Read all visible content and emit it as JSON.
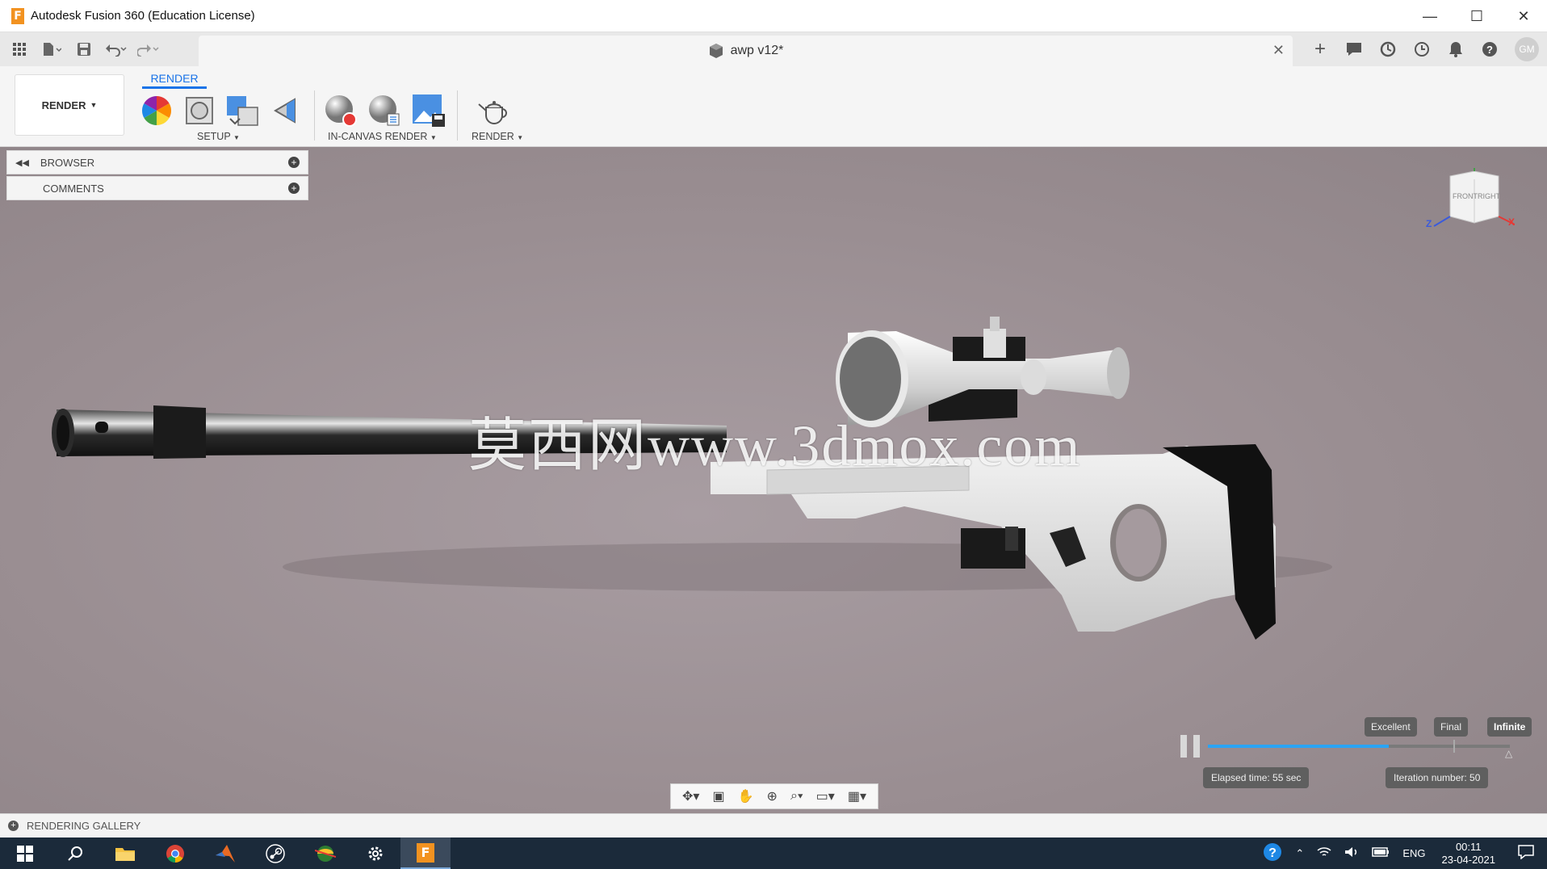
{
  "window": {
    "title": "Autodesk Fusion 360 (Education License)",
    "controls": {
      "minimize": "—",
      "maximize": "☐",
      "close": "✕"
    }
  },
  "document_tab": {
    "title": "awp v12*"
  },
  "user": {
    "initials": "GM"
  },
  "ribbon": {
    "workspace": "RENDER",
    "active_tab": "RENDER",
    "groups": [
      {
        "label": "SETUP"
      },
      {
        "label": "IN-CANVAS RENDER"
      },
      {
        "label": "RENDER"
      }
    ]
  },
  "browser": {
    "rows": [
      {
        "label": "BROWSER"
      },
      {
        "label": "COMMENTS"
      }
    ]
  },
  "viewcube": {
    "front": "FRONT",
    "right": "RIGHT",
    "axis_z": "Z",
    "axis_x": "X"
  },
  "watermark": "莫西网www.3dmox.com",
  "render_progress": {
    "quality_levels": [
      "Excellent",
      "Final",
      "Infinite"
    ],
    "active_level": "Infinite",
    "progress_fraction": 0.6,
    "elapsed": "Elapsed time: 55 sec",
    "iteration": "Iteration number: 50"
  },
  "gallery": {
    "label": "RENDERING GALLERY"
  },
  "taskbar": {
    "tray": {
      "language": "ENG",
      "time": "00:11",
      "date": "23-04-2021"
    }
  },
  "colors": {
    "accent": "#1a73e8",
    "progress": "#2aa4f4",
    "app_brand": "#f29220"
  }
}
